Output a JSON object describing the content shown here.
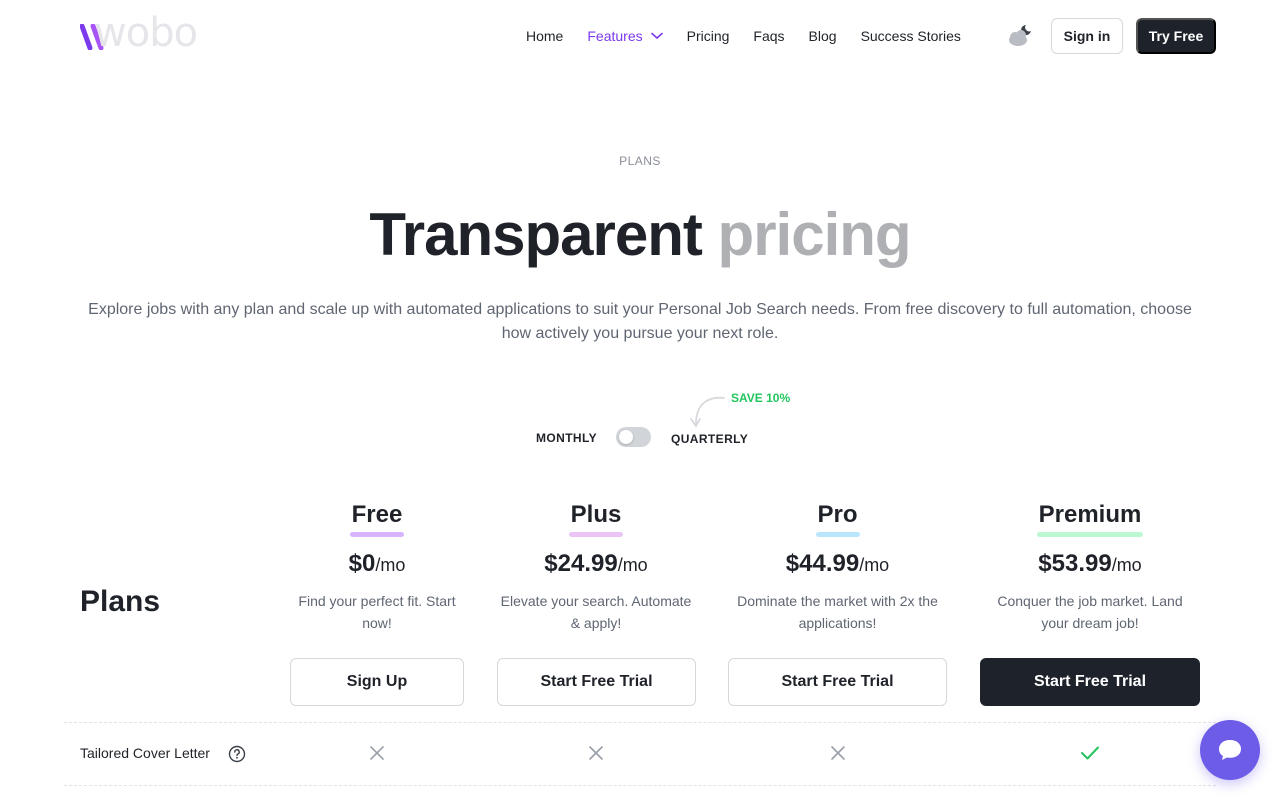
{
  "header": {
    "logo_text": "wobo",
    "nav": [
      {
        "label": "Home"
      },
      {
        "label": "Features"
      },
      {
        "label": "Pricing"
      },
      {
        "label": "Faqs"
      },
      {
        "label": "Blog"
      },
      {
        "label": "Success Stories"
      }
    ],
    "sign_in_label": "Sign in",
    "try_free_label": "Try Free"
  },
  "hero": {
    "eyebrow": "PLANS",
    "title_main": "Transparent",
    "title_muted": "pricing",
    "subtitle": "Explore jobs with any plan and scale up with automated applications to suit your Personal Job Search needs. From free discovery to full automation, choose how actively you pursue your next role."
  },
  "billing": {
    "monthly_label": "MONTHLY",
    "quarterly_label": "QUARTERLY",
    "save_badge": "SAVE 10%",
    "selected": "monthly"
  },
  "plans_heading": "Plans",
  "plans": [
    {
      "name": "Free",
      "price": "$0",
      "per": "/mo",
      "desc_line1": "Find your perfect fit. Start",
      "desc_line2": "now!",
      "button": "Sign Up",
      "accent": "#d8b4fe"
    },
    {
      "name": "Plus",
      "price": "$24.99",
      "per": "/mo",
      "desc_line1": "Elevate your search. Automate",
      "desc_line2": "& apply!",
      "button": "Start Free Trial",
      "accent": "#e9c4f5"
    },
    {
      "name": "Pro",
      "price": "$44.99",
      "per": "/mo",
      "desc_line1": "Dominate the market with 2x the",
      "desc_line2": "applications!",
      "button": "Start Free Trial",
      "accent": "#bae6fd"
    },
    {
      "name": "Premium",
      "price": "$53.99",
      "per": "/mo",
      "desc_line1": "Conquer the job market. Land",
      "desc_line2": "your dream job!",
      "button": "Start Free Trial",
      "accent": "#bbf7d0"
    }
  ],
  "features": [
    {
      "label": "Tailored Cover Letter",
      "included": [
        false,
        false,
        false,
        true
      ]
    }
  ],
  "colors": {
    "brand_purple": "#7c3aed",
    "dark_button": "#1e232b",
    "save_green": "#22c55e",
    "chat_purple": "#6d5ce7"
  },
  "icons": [
    "chevron-down-icon",
    "moon-cloud-icon",
    "help-circle-icon",
    "cross-icon",
    "check-icon",
    "chat-bubble-icon"
  ]
}
